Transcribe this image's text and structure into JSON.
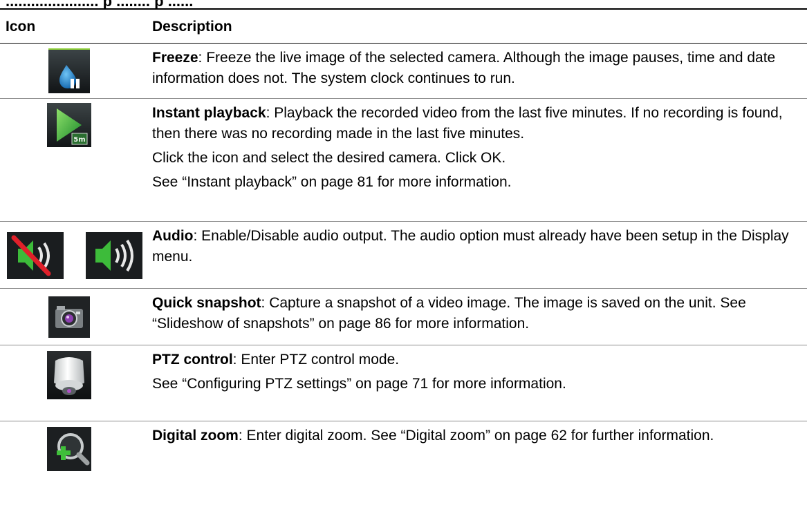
{
  "page": {
    "heading": "...................... p ........ p ......"
  },
  "table": {
    "headers": {
      "icon": "Icon",
      "description": "Description"
    },
    "rows": [
      {
        "icon_name": "freeze-icon",
        "term": "Freeze",
        "paragraphs": [
          "Freeze the live image of the selected camera. Although the image pauses, time and date information does not. The system clock continues to run."
        ]
      },
      {
        "icon_name": "instant-playback-icon",
        "icon_text": "5m",
        "term": "Instant playback",
        "paragraphs": [
          "Playback the recorded video from the last five minutes. If no recording is found, then there was no recording made in the last five minutes.",
          "Click the icon and select the desired camera. Click OK.",
          "See “Instant playback” on page 81 for more information."
        ]
      },
      {
        "icon_name": "audio-icons",
        "term": "Audio",
        "paragraphs": [
          "Enable/Disable audio output. The audio option must already have been setup in the Display menu."
        ]
      },
      {
        "icon_name": "quick-snapshot-icon",
        "term": "Quick snapshot",
        "paragraphs": [
          "Capture a snapshot of a video image. The image is saved on the unit. See “Slideshow of snapshots” on page 86 for more information."
        ]
      },
      {
        "icon_name": "ptz-control-icon",
        "term": "PTZ control",
        "paragraphs": [
          "Enter PTZ control mode.",
          "See “Configuring PTZ settings” on page 71 for more information."
        ]
      },
      {
        "icon_name": "digital-zoom-icon",
        "term": "Digital zoom",
        "paragraphs": [
          "Enter digital zoom. See “Digital zoom” on page 62 for further information."
        ]
      }
    ]
  }
}
